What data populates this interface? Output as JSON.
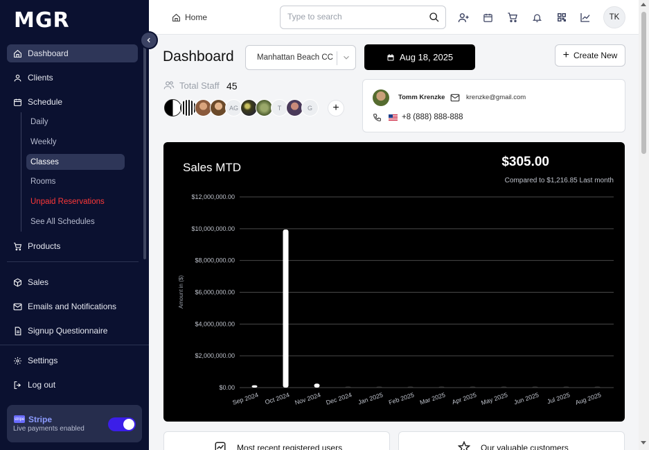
{
  "sidebar": {
    "logo": "MGR",
    "items": [
      {
        "label": "Dashboard",
        "icon": "home-icon",
        "active": true
      },
      {
        "label": "Clients",
        "icon": "user-icon"
      },
      {
        "label": "Schedule",
        "icon": "calendar-icon"
      },
      {
        "label": "Products",
        "icon": "cart-icon"
      },
      {
        "label": "Sales",
        "icon": "box-icon"
      },
      {
        "label": "Emails and Notifications",
        "icon": "mail-icon"
      },
      {
        "label": "Signup Questionnaire",
        "icon": "document-icon"
      },
      {
        "label": "Settings",
        "icon": "gear-icon"
      },
      {
        "label": "Log out",
        "icon": "logout-icon"
      }
    ],
    "schedule_sub": [
      {
        "label": "Daily"
      },
      {
        "label": "Weekly"
      },
      {
        "label": "Classes",
        "active": true
      },
      {
        "label": "Rooms"
      },
      {
        "label": "Unpaid Reservations",
        "color": "#ff3838"
      },
      {
        "label": "See All Schedules"
      }
    ],
    "stripe": {
      "name": "Stripe",
      "status": "Live payments enabled",
      "enabled": true,
      "logo_text": "stripe"
    }
  },
  "header": {
    "breadcrumb": "Home",
    "search_placeholder": "Type to search",
    "icons": [
      "add-user-icon",
      "calendar-icon",
      "cart-icon",
      "bell-icon",
      "qr-code-icon",
      "chart-icon"
    ],
    "user_initials": "TK"
  },
  "main": {
    "title": "Dashboard",
    "location": "Manhattan Beach CC",
    "date": "Aug 18, 2025",
    "create_label": "Create New",
    "staff": {
      "label": "Total Staff",
      "count": "45",
      "avatars": [
        {
          "type": "half-moon-icon"
        },
        {
          "type": "pattern"
        },
        {
          "type": "photo",
          "color": "#8a5a3c"
        },
        {
          "type": "photo",
          "color": "#6b4a2a"
        },
        {
          "type": "initials",
          "text": "AG"
        },
        {
          "type": "photo",
          "color": "#3d3d1a"
        },
        {
          "type": "photo",
          "color": "#5b6b3a"
        },
        {
          "type": "initials",
          "text": "T"
        },
        {
          "type": "photo",
          "color": "#4a3a5a"
        },
        {
          "type": "initials",
          "text": "G"
        }
      ]
    },
    "contact": {
      "name": "Tomm Krenzke",
      "email": "krenzke@gmail.com",
      "phone": "+8 (888) 888-888"
    },
    "sales": {
      "title": "Sales MTD",
      "amount": "$305.00",
      "comparison": "Compared to $1,216.85 Last month"
    },
    "bottom_cards": [
      {
        "title": "Most recent registered users",
        "icon": "activity-icon"
      },
      {
        "title": "Our valuable customers",
        "icon": "star-icon"
      }
    ]
  },
  "chart_data": {
    "type": "bar",
    "title": "Sales MTD",
    "ylabel": "Amount in ($)",
    "xlabel": "",
    "ylim": [
      0,
      12000000
    ],
    "yticks": [
      "$0.00",
      "$2,000,000.00",
      "$4,000,000.00",
      "$6,000,000.00",
      "$8,000,000.00",
      "$10,000,000.00",
      "$12,000,000.00"
    ],
    "categories": [
      "Sep 2024",
      "Oct 2024",
      "Nov 2024",
      "Dec 2024",
      "Jan 2025",
      "Feb 2025",
      "Mar 2025",
      "Apr 2025",
      "May 2025",
      "Jun 2025",
      "Jul 2025",
      "Aug 2025"
    ],
    "values": [
      150000,
      9950000,
      250000,
      0,
      0,
      0,
      0,
      0,
      0,
      0,
      0,
      0
    ],
    "grid": true,
    "background": "#000000",
    "bar_color": "#ffffff"
  }
}
